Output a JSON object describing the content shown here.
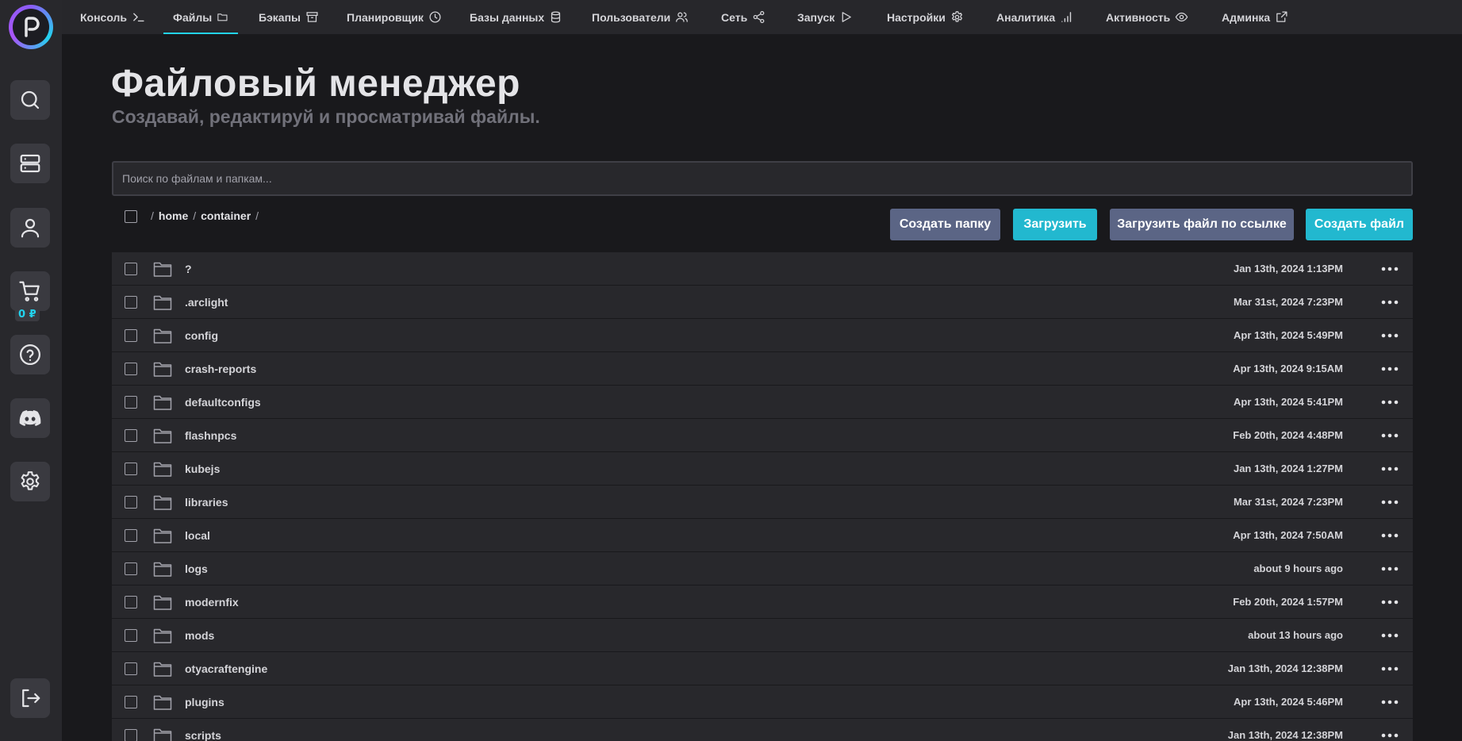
{
  "cart": {
    "balance": "0 ₽"
  },
  "nav": {
    "items": [
      {
        "label": "Консоль",
        "icon": "terminal-icon"
      },
      {
        "label": "Файлы",
        "icon": "folder-icon",
        "active": true
      },
      {
        "label": "Бэкапы",
        "icon": "archive-icon"
      },
      {
        "label": "Планировщик",
        "icon": "clock-icon"
      },
      {
        "label": "Базы данных",
        "icon": "database-icon"
      },
      {
        "label": "Пользователи",
        "icon": "users-icon"
      },
      {
        "label": "Сеть",
        "icon": "share-icon"
      },
      {
        "label": "Запуск",
        "icon": "play-icon"
      },
      {
        "label": "Настройки",
        "icon": "gear-icon"
      },
      {
        "label": "Аналитика",
        "icon": "signal-icon"
      },
      {
        "label": "Активность",
        "icon": "eye-icon"
      },
      {
        "label": "Админка",
        "icon": "external-link-icon"
      }
    ]
  },
  "page": {
    "title": "Файловый менеджер",
    "subtitle": "Создавай, редактируй и просматривай файлы."
  },
  "search": {
    "placeholder": "Поиск по файлам и папкам...",
    "value": ""
  },
  "breadcrumb": {
    "sep": "/",
    "parts": [
      "home",
      "container"
    ]
  },
  "actions": {
    "create_folder": "Создать папку",
    "upload": "Загрузить",
    "upload_url": "Загрузить файл по ссылке",
    "create_file": "Создать файл"
  },
  "colors": {
    "accent": "#22d3ee",
    "button_gray": "#5b6585",
    "button_cyan": "#22b8cf"
  },
  "files": [
    {
      "name": "?",
      "modified": "Jan 13th, 2024 1:13PM"
    },
    {
      "name": ".arclight",
      "modified": "Mar 31st, 2024 7:23PM"
    },
    {
      "name": "config",
      "modified": "Apr 13th, 2024 5:49PM"
    },
    {
      "name": "crash-reports",
      "modified": "Apr 13th, 2024 9:15AM"
    },
    {
      "name": "defaultconfigs",
      "modified": "Apr 13th, 2024 5:41PM"
    },
    {
      "name": "flashnpcs",
      "modified": "Feb 20th, 2024 4:48PM"
    },
    {
      "name": "kubejs",
      "modified": "Jan 13th, 2024 1:27PM"
    },
    {
      "name": "libraries",
      "modified": "Mar 31st, 2024 7:23PM"
    },
    {
      "name": "local",
      "modified": "Apr 13th, 2024 7:50AM"
    },
    {
      "name": "logs",
      "modified": "about 9 hours ago"
    },
    {
      "name": "modernfix",
      "modified": "Feb 20th, 2024 1:57PM"
    },
    {
      "name": "mods",
      "modified": "about 13 hours ago"
    },
    {
      "name": "otyacraftengine",
      "modified": "Jan 13th, 2024 12:38PM"
    },
    {
      "name": "plugins",
      "modified": "Apr 13th, 2024 5:46PM"
    },
    {
      "name": "scripts",
      "modified": "Jan 13th, 2024 12:38PM"
    }
  ]
}
